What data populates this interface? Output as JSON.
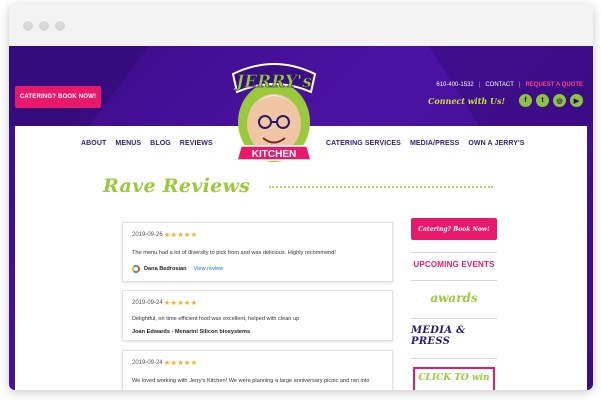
{
  "header": {
    "cater_button": "CATERING? BOOK NOW!",
    "phone": "610-400-1532",
    "contact": "CONTACT",
    "quote": "REQUEST A QUOTE",
    "connect": "Connect with Us!",
    "socials": [
      {
        "icon": "facebook-icon",
        "glyph": "f"
      },
      {
        "icon": "twitter-icon",
        "glyph": "t"
      },
      {
        "icon": "instagram-icon",
        "glyph": "◎"
      },
      {
        "icon": "youtube-icon",
        "glyph": "▶"
      }
    ]
  },
  "logo": {
    "top": "JERRY's",
    "bottom": "KITCHEN"
  },
  "nav": {
    "left": [
      "ABOUT",
      "MENUS",
      "BLOG",
      "REVIEWS"
    ],
    "right": [
      "CATERING SERVICES",
      "MEDIA/PRESS",
      "OWN A JERRY'S"
    ]
  },
  "page": {
    "title": "Rave Reviews"
  },
  "reviews": [
    {
      "date": "2019-09-26",
      "stars": "★★★★★",
      "text": "The menu had a lot of diversity to pick from and was delicious. Highly recommend!",
      "author": "Dana Bedrosian",
      "link": "View review"
    },
    {
      "date": "2019-09-24",
      "stars": "★★★★★",
      "text": "Delightful, on time efficient food was excellent, helped with clean up",
      "author": "Joan Edwards - Menarini Silicon biosystems"
    },
    {
      "date": "2019-09-24",
      "stars": "★★★★★",
      "text": "We loved working with Jerry's Kitchen! We were planning a large anniversary picnic and ran into"
    }
  ],
  "sidebar": {
    "cater_button": "Catering? Book Now!",
    "events": "UPCOMING EVENTS",
    "awards": "awards",
    "media": "MEDIA & PRESS",
    "click": "CLICK TO win"
  },
  "colors": {
    "brand_purple": "#3a0d86",
    "pink": "#e8196b",
    "lime": "#9ac93b"
  }
}
